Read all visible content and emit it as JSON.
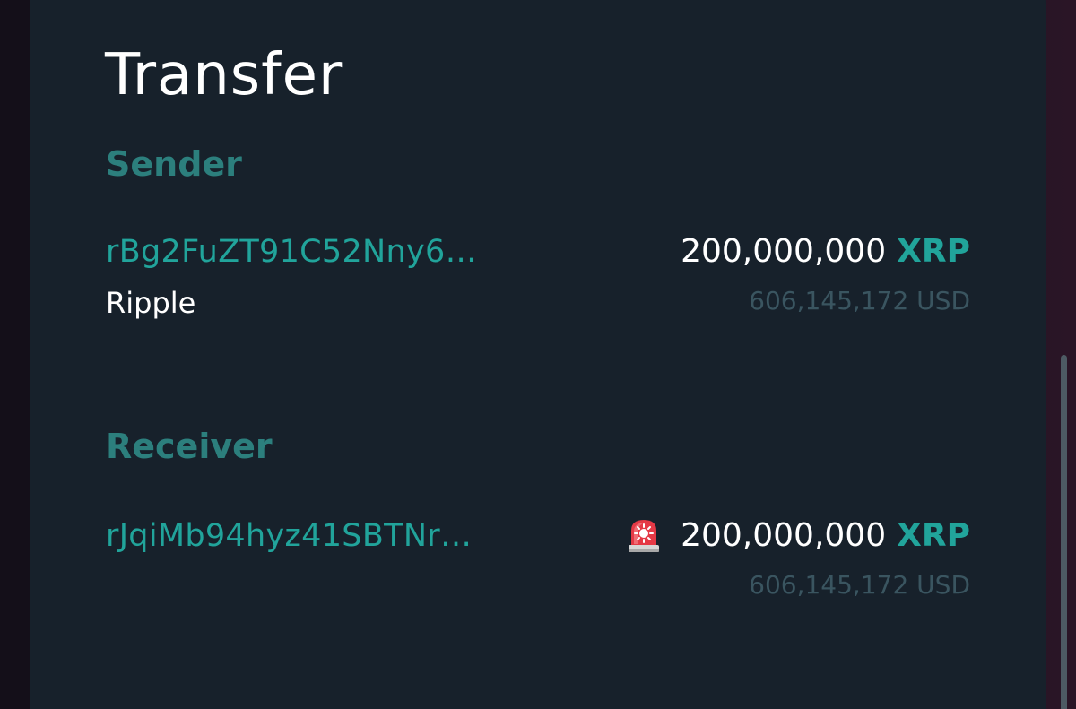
{
  "card": {
    "title": "Transfer"
  },
  "sender": {
    "section_label": "Sender",
    "address": "rBg2FuZT91C52Nny6…",
    "name": "Ripple",
    "amount": "200,000,000",
    "currency": "XRP",
    "fiat_value": "606,145,172 USD"
  },
  "receiver": {
    "section_label": "Receiver",
    "address": "rJqiMb94hyz41SBTNr…",
    "amount": "200,000,000",
    "currency": "XRP",
    "fiat_value": "606,145,172 USD",
    "alert_icon": "police-light-icon"
  },
  "colors": {
    "card_background": "#17212b",
    "accent": "#21a49b",
    "section_label": "#2c7f7d",
    "fiat_text": "#3a5560"
  }
}
